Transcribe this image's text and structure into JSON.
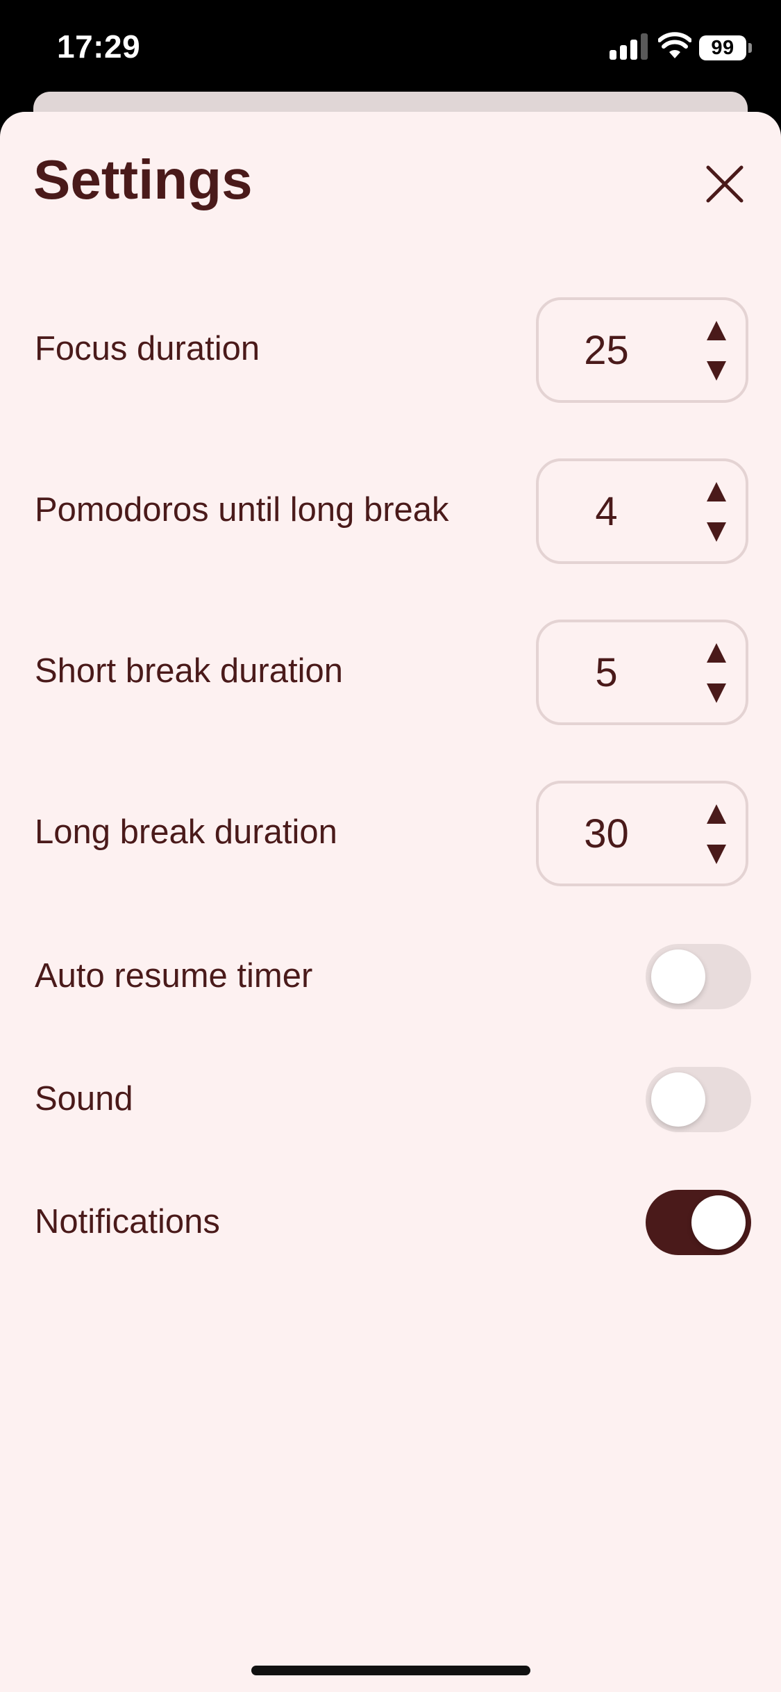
{
  "status_bar": {
    "time": "17:29",
    "battery_level": "99",
    "signal_icon": "cellular-signal-icon",
    "wifi_icon": "wifi-icon"
  },
  "sheet": {
    "title": "Settings",
    "close_icon": "close-icon"
  },
  "steppers": [
    {
      "label": "Focus duration",
      "value": "25"
    },
    {
      "label": "Pomodoros until long break",
      "value": "4"
    },
    {
      "label": "Short break duration",
      "value": "5"
    },
    {
      "label": "Long break duration",
      "value": "30"
    }
  ],
  "toggles": [
    {
      "label": "Auto resume timer",
      "on": false
    },
    {
      "label": "Sound",
      "on": false
    },
    {
      "label": "Notifications",
      "on": true
    }
  ],
  "colors": {
    "accent": "#4a1a1a",
    "sheet_background": "#fdf1f1",
    "toggle_off": "#e8dcdc",
    "stepper_border": "#e4d3d3"
  }
}
